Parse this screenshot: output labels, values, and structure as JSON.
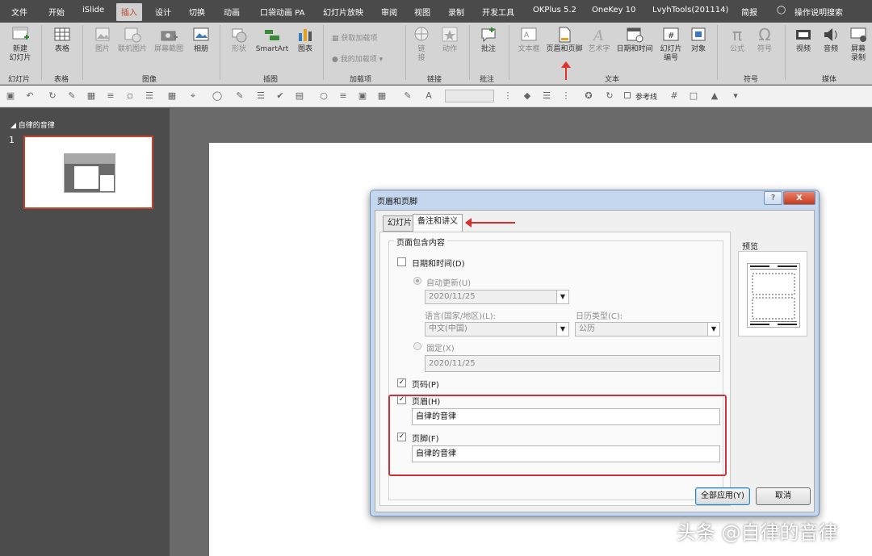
{
  "menu": {
    "items": [
      "文件",
      "开始",
      "iSlide",
      "插入",
      "设计",
      "切换",
      "动画",
      "口袋动画 PA",
      "幻灯片放映",
      "审阅",
      "视图",
      "录制",
      "开发工具",
      "OKPlus 5.2",
      "OneKey 10",
      "LvyhTools(201114)",
      "简报",
      "操作说明搜索"
    ],
    "active": "插入"
  },
  "ribbon": {
    "buttons": {
      "new_slide": "新建\n幻灯片",
      "table": "表格",
      "picture": "图片",
      "online_picture": "联机图片",
      "screenshot": "屏幕截图",
      "album": "相册",
      "shapes": "形状",
      "smartart": "SmartArt",
      "chart": "图表",
      "get_addins": "获取加载项",
      "my_addins": "我的加载项",
      "link": "链\n接",
      "action": "动作",
      "comment": "批注",
      "textbox": "文本框",
      "header_footer": "页眉和页脚",
      "wordart": "艺术字",
      "datetime": "日期和时间",
      "slide_number": "幻灯片\n编号",
      "object": "对象",
      "equation": "公式",
      "symbol": "符号",
      "video": "视频",
      "audio": "音频",
      "screen_record": "屏幕\n录制"
    },
    "groups": {
      "slides": "幻灯片",
      "tables": "表格",
      "images": "图像",
      "illustrations": "插图",
      "addins": "加载项",
      "links": "链接",
      "comments": "批注",
      "text": "文本",
      "symbols": "符号",
      "media": "媒体"
    }
  },
  "qat": {
    "guides_label": "参考线"
  },
  "slides_panel": {
    "section_title": "自律的音律",
    "slide_number": "1"
  },
  "dialog": {
    "title": "页眉和页脚",
    "help": "?",
    "close": "X",
    "tabs": [
      "幻灯片",
      "备注和讲义"
    ],
    "selected_tab": "备注和讲义",
    "group_legend": "页面包含内容",
    "date_time_label": "日期和时间(D)",
    "auto_update_label": "自动更新(U)",
    "auto_update_value": "2020/11/25",
    "language_label": "语言(国家/地区)(L):",
    "language_value": "中文(中国)",
    "calendar_label": "日历类型(C):",
    "calendar_value": "公历",
    "fixed_label": "固定(X)",
    "fixed_value": "2020/11/25",
    "page_number_label": "页码(P)",
    "header_label": "页眉(H)",
    "header_value": "自律的音律",
    "footer_label": "页脚(F)",
    "footer_value": "自律的音律",
    "preview_label": "预览",
    "apply_all": "全部应用(Y)",
    "cancel": "取消"
  },
  "watermark": "头条 @自律的音律",
  "colors": {
    "accent": "#b8452a",
    "annotation_red": "#d52f2f",
    "menubar": "#4a4a4a"
  }
}
